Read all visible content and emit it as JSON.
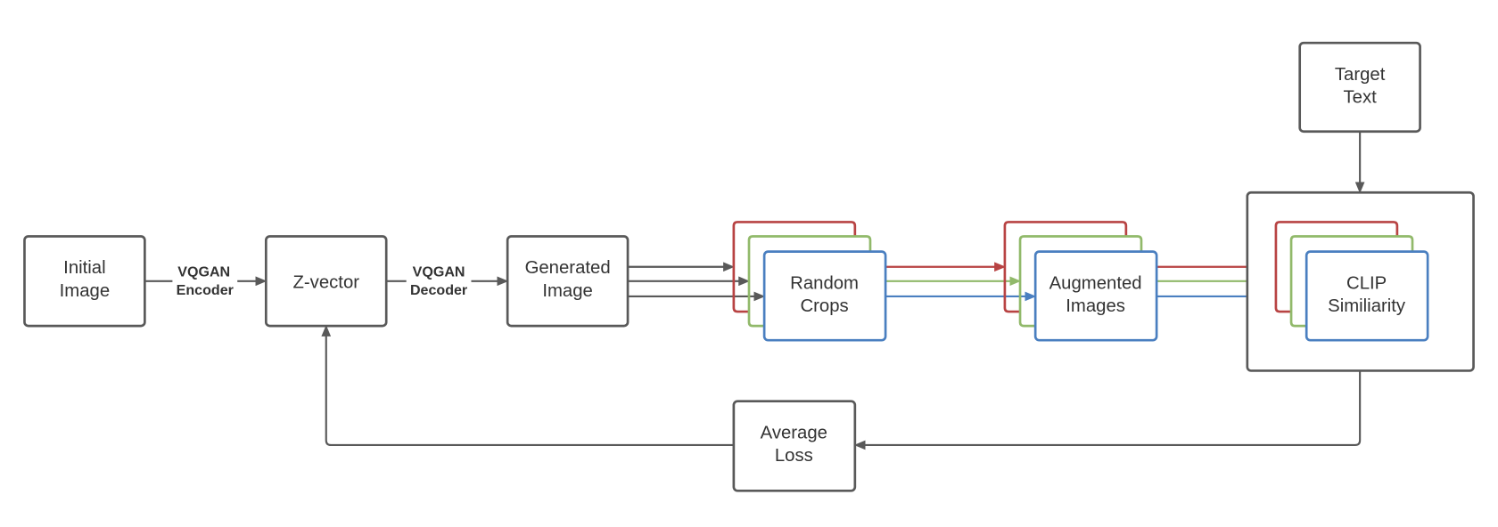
{
  "colors": {
    "node": "#595959",
    "red": "#b84343",
    "green": "#91b96a",
    "blue": "#4a7fc0",
    "text": "#333333"
  },
  "nodes": {
    "initial_image": [
      "Initial",
      "Image"
    ],
    "z_vector": [
      "Z-vector"
    ],
    "generated_image": [
      "Generated",
      "Image"
    ],
    "random_crops": [
      "Random",
      "Crops"
    ],
    "augmented_images": [
      "Augmented",
      "Images"
    ],
    "clip_similarity": [
      "CLIP",
      "Similiarity"
    ],
    "target_text": [
      "Target",
      "Text"
    ],
    "average_loss": [
      "Average",
      "Loss"
    ]
  },
  "edges": {
    "encoder": [
      "VQGAN",
      "Encoder"
    ],
    "decoder": [
      "VQGAN",
      "Decoder"
    ]
  }
}
